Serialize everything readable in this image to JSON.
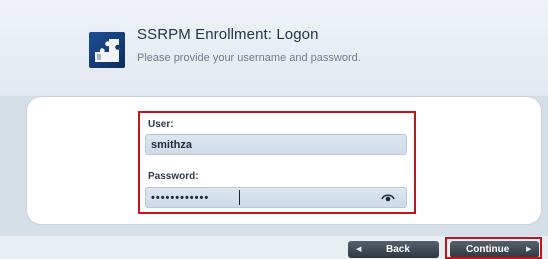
{
  "header": {
    "title": "SSRPM Enrollment: Logon",
    "subtitle": "Please provide your username and password.",
    "logo_icon": "puzzle-logo-icon"
  },
  "form": {
    "user_label": "User:",
    "user_value": "smithza",
    "password_label": "Password:",
    "password_value": "••••••••••••",
    "reveal_icon": "eye-icon"
  },
  "footer": {
    "back_label": "Back",
    "continue_label": "Continue"
  },
  "colors": {
    "highlight": "#c4141a",
    "button": "#3a434d",
    "input_fill": "#d4dfeb"
  }
}
